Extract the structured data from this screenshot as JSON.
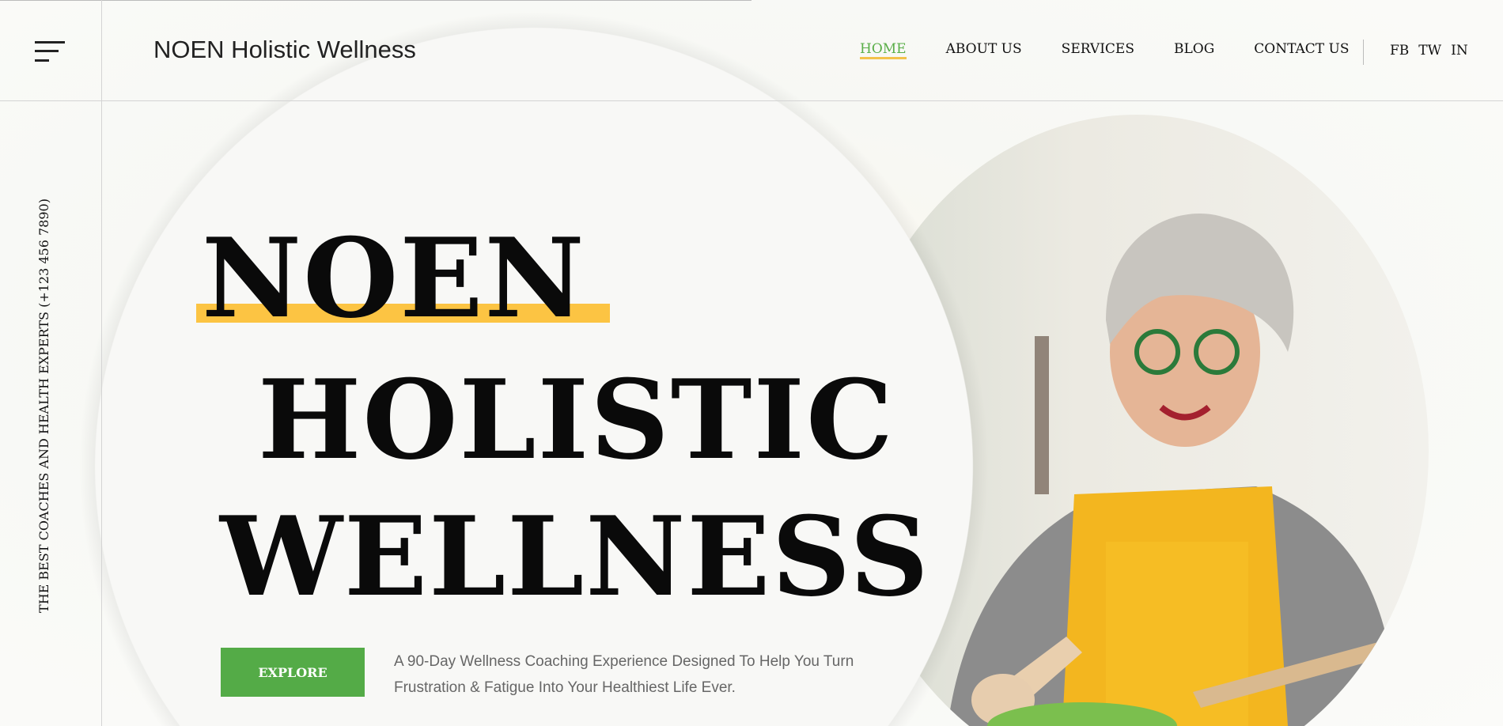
{
  "header": {
    "title": "NOEN Holistic Wellness",
    "nav": [
      {
        "label": "HOME",
        "active": true
      },
      {
        "label": "ABOUT US"
      },
      {
        "label": "SERVICES"
      },
      {
        "label": "BLOG"
      },
      {
        "label": "CONTACT US"
      }
    ],
    "social": [
      "FB",
      "TW",
      "IN"
    ]
  },
  "sidebar": {
    "tagline": "THE BEST COACHES AND HEALTH EXPERTS (+123 456 7890)"
  },
  "hero": {
    "line1": "NOEN",
    "line2": "HOLISTIC",
    "line3": "WELLNESS",
    "button": "EXPLORE",
    "description": "A 90-Day Wellness Coaching Experience Designed To Help You Turn Frustration & Fatigue Into Your Healthiest Life Ever."
  },
  "colors": {
    "accent": "#54ab47",
    "highlight": "#fcc443"
  }
}
